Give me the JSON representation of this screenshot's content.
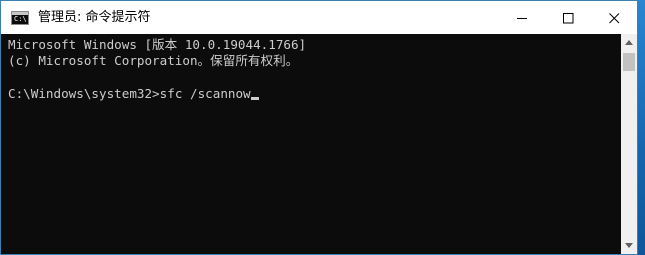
{
  "window": {
    "title": "管理员: 命令提示符",
    "icon": "cmd-icon",
    "icon_glyph": "C:\\"
  },
  "controls": {
    "minimize": "minimize-icon",
    "maximize": "maximize-icon",
    "close": "close-icon"
  },
  "console": {
    "line1": "Microsoft Windows [版本 10.0.19044.1766]",
    "line2": "(c) Microsoft Corporation。保留所有权利。",
    "prompt": "C:\\Windows\\system32>",
    "command": "sfc /scannow"
  },
  "scrollbar": {
    "up": "scroll-up-arrow-icon",
    "down": "scroll-down-arrow-icon"
  },
  "colors": {
    "console_background": "#0c0c0c",
    "console_text": "#cccccc",
    "titlebar_background": "#ffffff",
    "desktop_background": "#1a6fb5"
  }
}
